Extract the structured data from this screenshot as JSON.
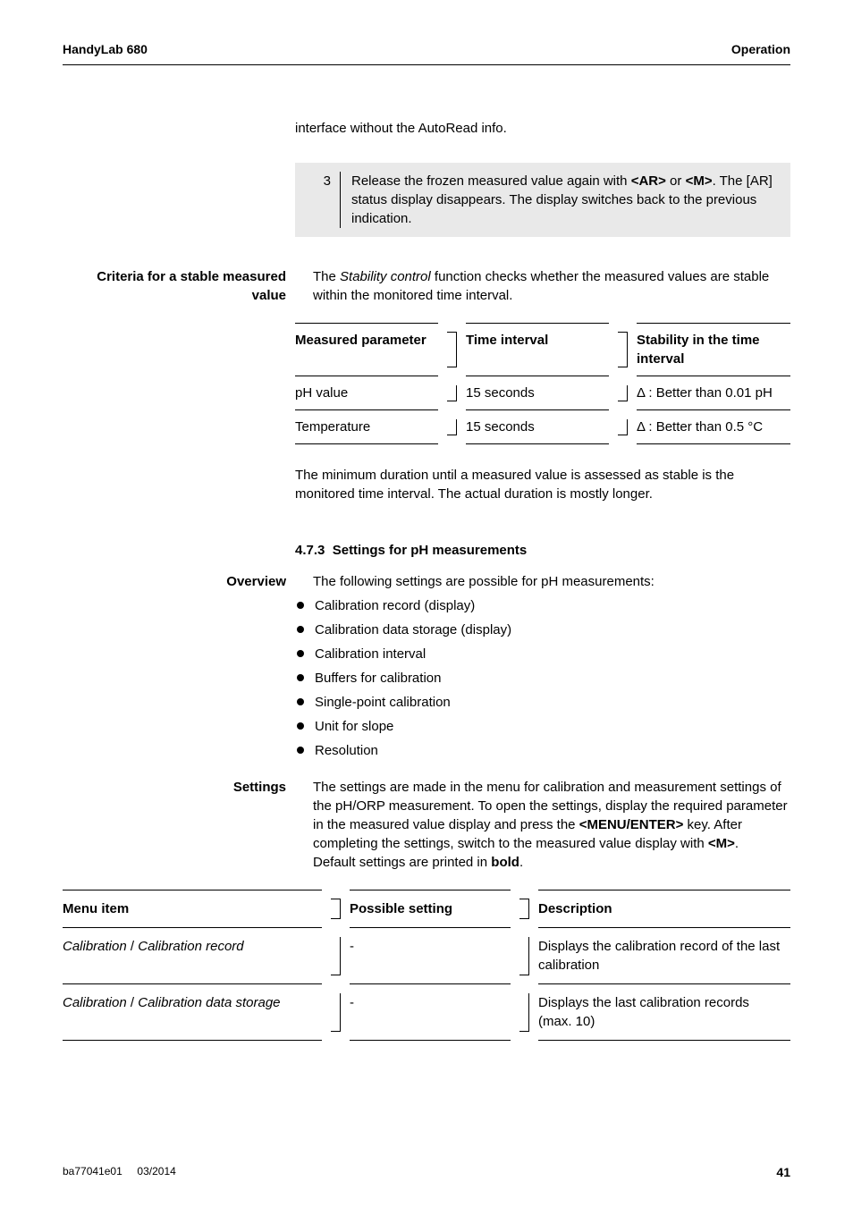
{
  "header": {
    "left": "HandyLab 680",
    "right": "Operation"
  },
  "intro": "interface without the AutoRead info.",
  "step": {
    "num": "3",
    "text_pre": "Release the frozen measured value again with ",
    "ar": "<AR>",
    "or": " or ",
    "m": "<M>",
    "text_mid": ". The [AR] status display disappears. The display switches back to the previous indication."
  },
  "criteria": {
    "label": "Criteria for a stable measured value",
    "body_pre": "The ",
    "body_it": "Stability control",
    "body_post": " function checks whether the measured values are stable within the monitored time interval."
  },
  "stab_table": {
    "h1": "Measured parameter",
    "h2": "Time interval",
    "h3": "Stability in the time interval",
    "rows": [
      {
        "a": "pH value",
        "b": "15 seconds",
        "c": "Δ : Better than 0.01 pH"
      },
      {
        "a": "Temperature",
        "b": "15 seconds",
        "c": "Δ : Better than 0.5 °C"
      }
    ]
  },
  "after_table": "The minimum duration until a measured value is assessed as stable is the monitored time interval. The actual duration is mostly longer.",
  "section473": {
    "num": "4.7.3",
    "title": "Settings for pH measurements"
  },
  "overview": {
    "label": "Overview",
    "intro": "The following settings are possible for pH measurements:",
    "items": [
      "Calibration record (display)",
      "Calibration data storage (display)",
      "Calibration interval",
      "Buffers for calibration",
      "Single-point calibration",
      "Unit for slope",
      "Resolution"
    ]
  },
  "settings": {
    "label": "Settings",
    "para_pre": "The settings are made in the menu for calibration and measurement settings of the pH/ORP measurement. To open the settings, display the required parameter in the measured value display and press the ",
    "menu_key": "<MENU/ENTER>",
    "para_mid": " key. After completing the settings, switch to the measured value display with ",
    "m_key": "<M>",
    "para_post": ".",
    "default_pre": "Default settings are printed in ",
    "default_bold": "bold",
    "default_post": "."
  },
  "menu_table": {
    "h1": "Menu item",
    "h2": "Possible setting",
    "h3": "Description",
    "rows": [
      {
        "a_it1": "Calibration",
        "a_sep": " / ",
        "a_it2": "Calibration record",
        "b": "-",
        "c": "Displays the calibration record of the last calibration"
      },
      {
        "a_it1": "Calibration",
        "a_sep": " / ",
        "a_it2": "Calibration data storage",
        "b": "-",
        "c": "Displays the last calibration records (max. 10)"
      }
    ]
  },
  "footer": {
    "left1": "ba77041e01",
    "left2": "03/2014",
    "page": "41"
  }
}
